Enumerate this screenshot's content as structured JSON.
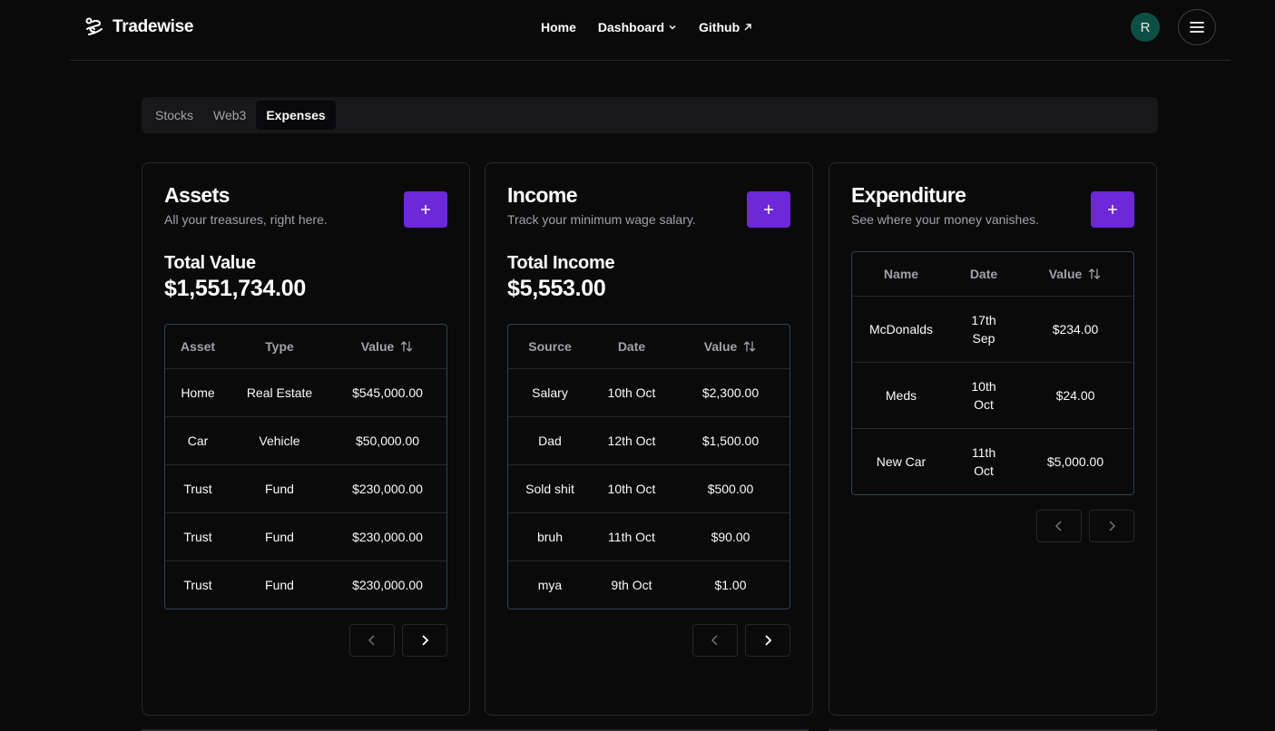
{
  "brand": {
    "name": "Tradewise"
  },
  "nav": {
    "home": "Home",
    "dashboard": "Dashboard",
    "github": "Github"
  },
  "user": {
    "avatar_initial": "R",
    "avatar_color": "#0d4f45"
  },
  "tabs": [
    {
      "label": "Stocks",
      "active": false
    },
    {
      "label": "Web3",
      "active": false
    },
    {
      "label": "Expenses",
      "active": true
    }
  ],
  "accent_color": "#6d28d9",
  "assets": {
    "title": "Assets",
    "description": "All your treasures, right here.",
    "total_label": "Total Value",
    "total_value": "$1,551,734.00",
    "columns": [
      "Asset",
      "Type",
      "Value"
    ],
    "rows": [
      [
        "Home",
        "Real Estate",
        "$545,000.00"
      ],
      [
        "Car",
        "Vehicle",
        "$50,000.00"
      ],
      [
        "Trust",
        "Fund",
        "$230,000.00"
      ],
      [
        "Trust",
        "Fund",
        "$230,000.00"
      ],
      [
        "Trust",
        "Fund",
        "$230,000.00"
      ]
    ]
  },
  "income": {
    "title": "Income",
    "description": "Track your minimum wage salary.",
    "total_label": "Total Income",
    "total_value": "$5,553.00",
    "columns": [
      "Source",
      "Date",
      "Value"
    ],
    "rows": [
      [
        "Salary",
        "10th Oct",
        "$2,300.00"
      ],
      [
        "Dad",
        "12th Oct",
        "$1,500.00"
      ],
      [
        "Sold shit",
        "10th Oct",
        "$500.00"
      ],
      [
        "bruh",
        "11th Oct",
        "$90.00"
      ],
      [
        "mya",
        "9th Oct",
        "$1.00"
      ]
    ]
  },
  "expenditure": {
    "title": "Expenditure",
    "description": "See where your money vanishes.",
    "columns": [
      "Name",
      "Date",
      "Value"
    ],
    "rows": [
      [
        "McDonalds",
        "17th Sep",
        "$234.00"
      ],
      [
        "Meds",
        "10th Oct",
        "$24.00"
      ],
      [
        "New Car",
        "11th Oct",
        "$5,000.00"
      ]
    ]
  }
}
